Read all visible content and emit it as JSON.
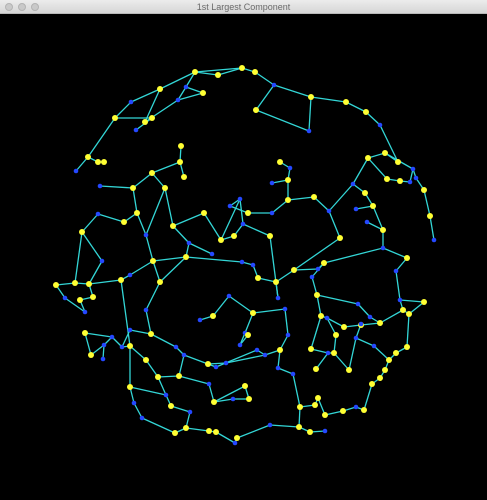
{
  "window": {
    "title": "1st Largest Component",
    "controls": [
      {
        "name": "close-button",
        "color": "#c9c9c9"
      },
      {
        "name": "minimize-button",
        "color": "#c9c9c9"
      },
      {
        "name": "zoom-button",
        "color": "#c9c9c9"
      }
    ]
  },
  "graph": {
    "background": "#000000",
    "edge_color": "#33d6d6",
    "node_colors": {
      "yellow": "#ffff33",
      "blue": "#2448ff"
    }
  }
}
